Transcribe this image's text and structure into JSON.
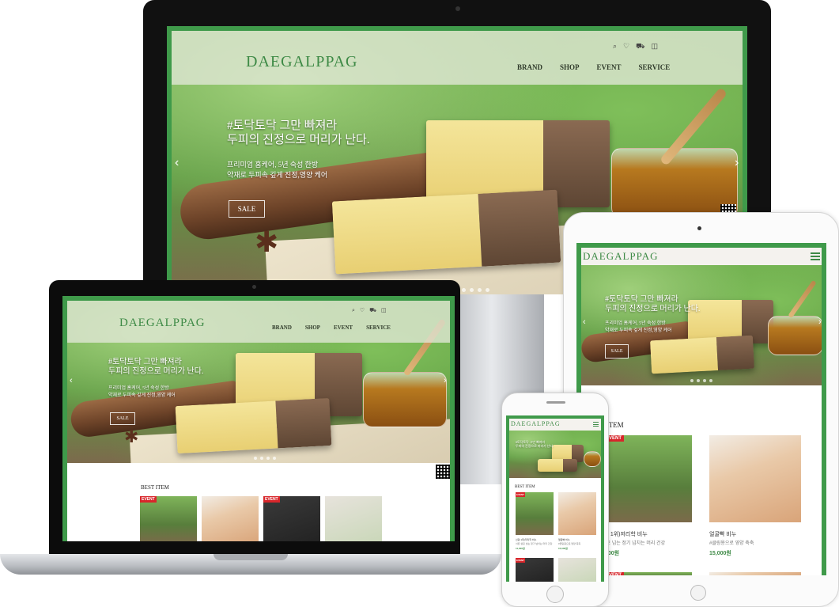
{
  "brand": {
    "logo": "DAEGALPPAG",
    "accent": "#3f9a4a"
  },
  "nav": {
    "items": [
      "BRAND",
      "SHOP",
      "EVENT",
      "SERVICE"
    ]
  },
  "header_icons": [
    "search-icon",
    "heart-icon",
    "truck-icon",
    "bag-icon"
  ],
  "hero": {
    "headline_1": "#토닥토닥 그만 빠져라",
    "headline_2": "두피의 진정으로 머리가 난다.",
    "sub_1": "프리미엄 홈케어, 5년 숙성 한방",
    "sub_2": "약재로 두피속 깊게 진정,영양 케어",
    "button": "SALE",
    "prev": "‹",
    "next": "›"
  },
  "best": {
    "title": "BEST ITEM",
    "title_cut": "T ITEM",
    "badge": "EVENT",
    "products": [
      {
        "name": "신랑 1위)저리학 비누",
        "name_cut": "선랑 1위)저리학 비누",
        "desc": "서른 살로 넘는 정기 넘치는 머리 건강",
        "desc_cut": "르므 넘는 정기 넘치는 머리 건강",
        "price": "11,000원",
        "price_cut": ".000원"
      },
      {
        "name": "얼굴빡 비누",
        "desc": "#클링용으로 영양 축축",
        "price": "15,000원"
      }
    ]
  }
}
